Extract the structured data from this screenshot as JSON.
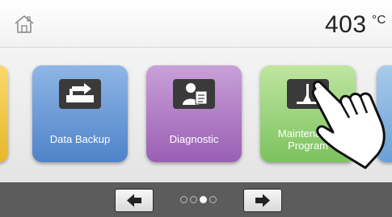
{
  "header": {
    "home_icon": "home-icon",
    "temperature": "403",
    "unit": "°C"
  },
  "tiles": [
    {
      "label": "Data Backup",
      "icon": "data-backup-icon",
      "color": "#5f8fd0"
    },
    {
      "label": "Diagnostic",
      "icon": "diagnostic-icon",
      "color": "#a66cbf"
    },
    {
      "label_line1": "Maintenance",
      "label_line2": "Program",
      "icon": "maintenance-icon",
      "color": "#86c768"
    }
  ],
  "pager": {
    "prev_icon": "arrow-left-icon",
    "next_icon": "arrow-right-icon",
    "page_count": 4,
    "active_page": 3
  },
  "overlay": {
    "icon": "pointing-hand-icon"
  }
}
